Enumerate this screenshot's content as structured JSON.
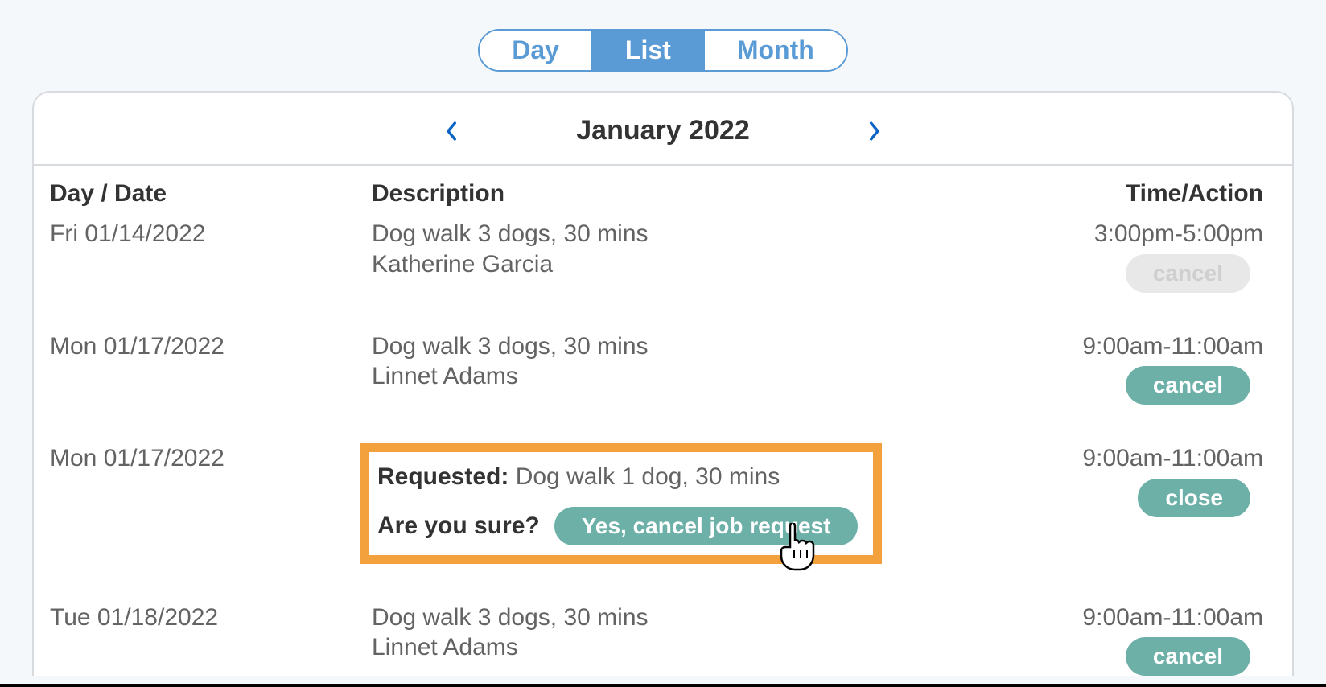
{
  "view_tabs": {
    "day": "Day",
    "list": "List",
    "month": "Month",
    "active": "list"
  },
  "calendar": {
    "title": "January 2022"
  },
  "columns": {
    "day_date": "Day / Date",
    "description": "Description",
    "time_action": "Time/Action"
  },
  "rows": [
    {
      "date": "Fri 01/14/2022",
      "desc1": "Dog walk 3 dogs, 30 mins",
      "desc2": "Katherine Garcia",
      "time": "3:00pm-5:00pm",
      "action_label": "cancel",
      "action_state": "disabled"
    },
    {
      "date": "Mon 01/17/2022",
      "desc1": "Dog walk 3 dogs, 30 mins",
      "desc2": "Linnet Adams",
      "time": "9:00am-11:00am",
      "action_label": "cancel",
      "action_state": "enabled"
    },
    {
      "date": "Mon 01/17/2022",
      "requested_label": "Requested:",
      "requested_text": " Dog walk 1 dog, 30 mins",
      "confirm_q": "Are you sure?",
      "confirm_btn": "Yes, cancel job request",
      "time": "9:00am-11:00am",
      "action_label": "close",
      "action_state": "enabled"
    },
    {
      "date": "Tue 01/18/2022",
      "desc1": "Dog walk 3 dogs, 30 mins",
      "desc2": "Linnet Adams",
      "time": "9:00am-11:00am",
      "action_label": "cancel",
      "action_state": "enabled"
    }
  ]
}
